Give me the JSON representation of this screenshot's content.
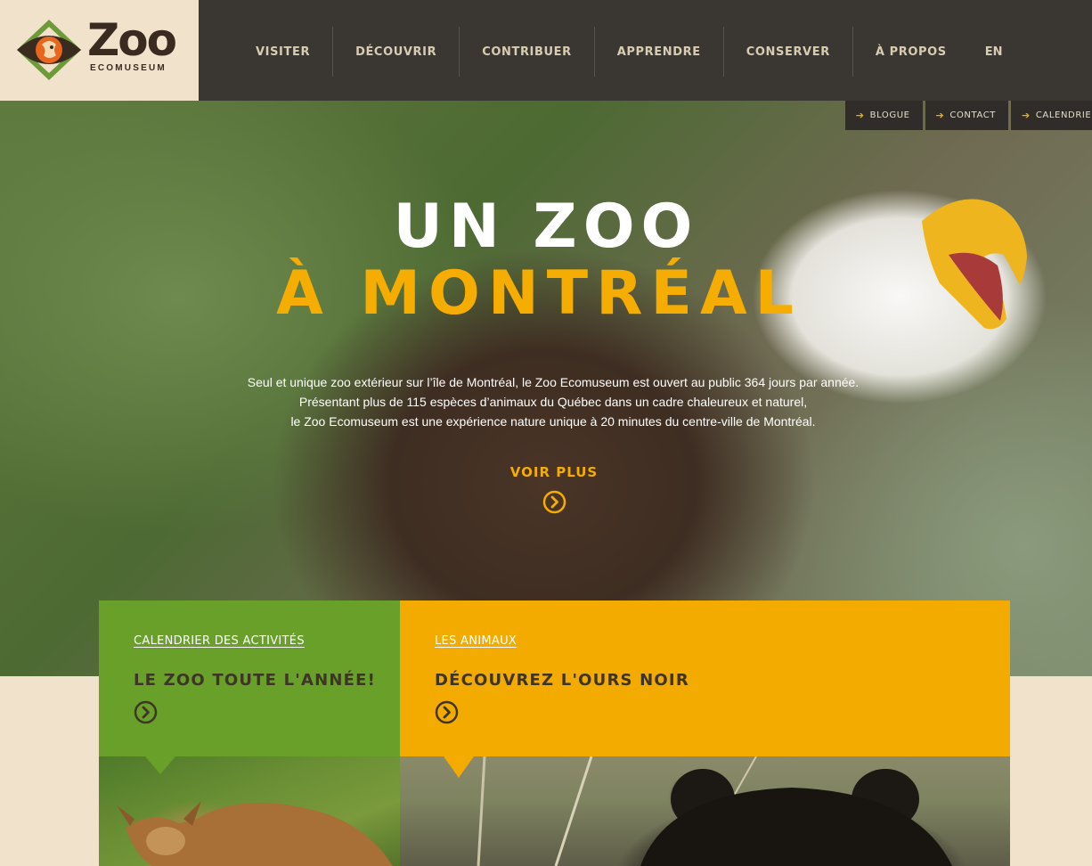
{
  "brand": {
    "wordmark": "Zoo",
    "subtitle": "ECOMUSEUM",
    "colors": {
      "orange": "#f4ad00",
      "green": "#68a02a",
      "dark": "#3a3632",
      "cream": "#f1e2cc"
    }
  },
  "nav": {
    "items": [
      {
        "label": "VISITER"
      },
      {
        "label": "DÉCOUVRIR"
      },
      {
        "label": "CONTRIBUER"
      },
      {
        "label": "APPRENDRE"
      },
      {
        "label": "CONSERVER"
      },
      {
        "label": "À PROPOS"
      }
    ],
    "lang": "EN"
  },
  "subnav": {
    "arrow_icon": "arrow-right-icon",
    "items": [
      {
        "label": "BLOGUE"
      },
      {
        "label": "CONTACT"
      },
      {
        "label": "CALENDRIER"
      }
    ]
  },
  "hero": {
    "title_line1": "UN ZOO",
    "title_line2": "À MONTRÉAL",
    "description": [
      "Seul et unique zoo extérieur sur l’île de Montréal, le Zoo Ecomuseum est ouvert au public 364 jours par année.",
      "Présentant plus de 115 espèces d’animaux du Québec dans un cadre chaleureux et naturel,",
      "le Zoo Ecomuseum est une expérience nature unique à 20 minutes du centre-ville de Montréal."
    ],
    "cta": "VOIR PLUS",
    "cta_icon": "chevron-circle-right-icon"
  },
  "cards": [
    {
      "category": "CALENDRIER DES ACTIVITÉS",
      "headline": "LE ZOO TOUTE L'ANNÉE!",
      "icon": "chevron-circle-right-icon"
    },
    {
      "category": "LES ANIMAUX",
      "headline": "DÉCOUVREZ L'OURS NOIR",
      "icon": "chevron-circle-right-icon"
    }
  ]
}
